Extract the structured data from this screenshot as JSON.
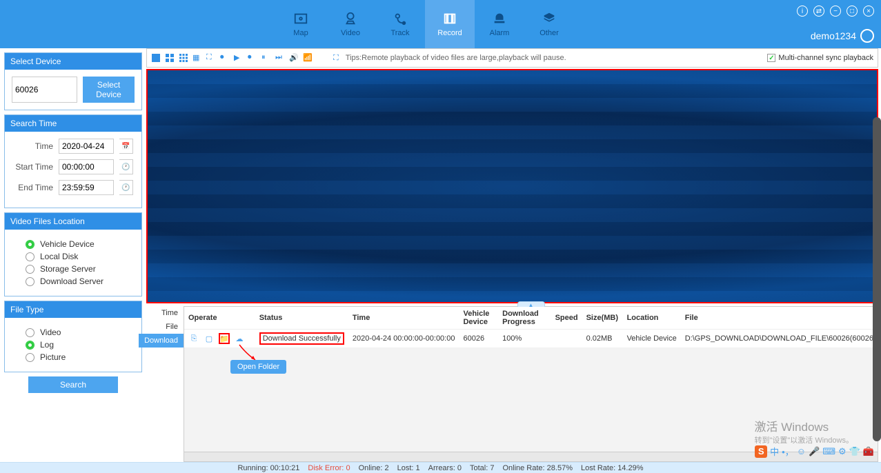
{
  "header": {
    "tabs": [
      {
        "key": "map",
        "label": "Map"
      },
      {
        "key": "video",
        "label": "Video"
      },
      {
        "key": "track",
        "label": "Track"
      },
      {
        "key": "record",
        "label": "Record"
      },
      {
        "key": "alarm",
        "label": "Alarm"
      },
      {
        "key": "other",
        "label": "Other"
      }
    ],
    "user": "demo1234"
  },
  "sidebar": {
    "select_device": {
      "title": "Select Device",
      "value": "60026",
      "button": "Select Device"
    },
    "search_time": {
      "title": "Search Time",
      "time_label": "Time",
      "time_value": "2020-04-24",
      "start_label": "Start Time",
      "start_value": "00:00:00",
      "end_label": "End Time",
      "end_value": "23:59:59"
    },
    "location": {
      "title": "Video Files Location",
      "options": [
        "Vehicle Device",
        "Local Disk",
        "Storage Server",
        "Download Server"
      ],
      "selected": 0
    },
    "file_type": {
      "title": "File Type",
      "options": [
        "Video",
        "Log",
        "Picture"
      ],
      "selected": 1
    },
    "search_button": "Search"
  },
  "toolbar": {
    "tips": "Tips:Remote playback of video files are large,playback will pause.",
    "multi_sync": "Multi-channel sync playback"
  },
  "side_tabs": [
    "Time",
    "File",
    "Download"
  ],
  "table": {
    "headers": [
      "Operate",
      "Status",
      "Time",
      "Vehicle Device",
      "Download Progress",
      "Speed",
      "Size(MB)",
      "Location",
      "File"
    ],
    "row": {
      "status": "Download Successfully",
      "time": "2020-04-24 00:00:00-00:00:00",
      "vehicle": "60026",
      "progress": "100%",
      "speed": "",
      "size": "0.02MB",
      "location": "Vehicle Device",
      "file": "D:\\GPS_DOWNLOAD\\DOWNLOAD_FILE\\60026(60026"
    },
    "tooltip": "Open Folder"
  },
  "footer": {
    "running_label": "Running:",
    "running": "00:10:21",
    "disk_label": "Disk Error:",
    "disk": "0",
    "online_label": "Online:",
    "online": "2",
    "lost_label": "Lost:",
    "lost": "1",
    "arrears_label": "Arrears:",
    "arrears": "0",
    "total_label": "Total:",
    "total": "7",
    "online_rate_label": "Online Rate:",
    "online_rate": "28.57%",
    "lost_rate_label": "Lost Rate:",
    "lost_rate": "14.29%"
  },
  "watermark": {
    "line1": "激活 Windows",
    "line2": "转到\"设置\"以激活 Windows。"
  }
}
